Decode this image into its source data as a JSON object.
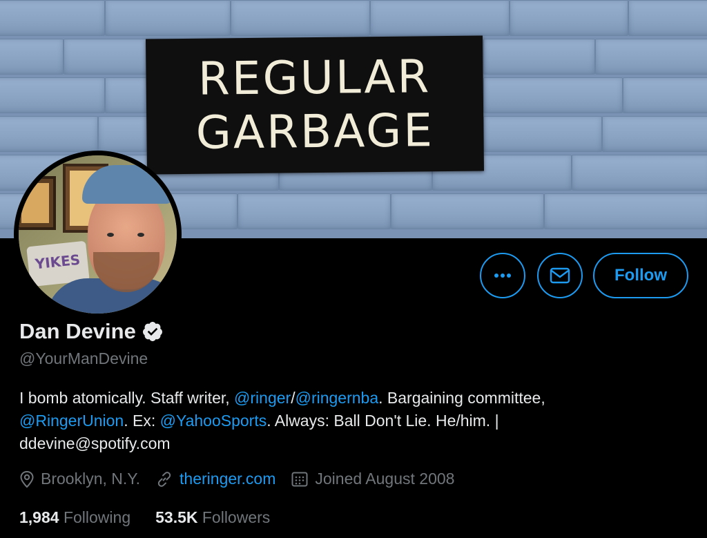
{
  "banner": {
    "sign_line1": "REGULAR",
    "sign_line2": "GARBAGE"
  },
  "avatar": {
    "pillow_text": "YIKES"
  },
  "actions": {
    "more_icon": "more-horizontal-icon",
    "message_icon": "mail-icon",
    "follow_label": "Follow"
  },
  "profile": {
    "name": "Dan Devine",
    "verified_icon": "verified-badge-icon",
    "handle": "@YourManDevine",
    "bio": {
      "t1": "I bomb atomically. Staff writer, ",
      "m1": "@ringer",
      "t2": "/",
      "m2": "@ringernba",
      "t3": ". Bargaining committee,",
      "m3": "@RingerUnion",
      "t4": ". Ex: ",
      "m4": "@YahooSports",
      "t5": ". Always: Ball Don't Lie. He/him. |",
      "t6": "ddevine@spotify.com"
    },
    "location": "Brooklyn, N.Y.",
    "website": "theringer.com",
    "joined": "Joined August 2008"
  },
  "stats": {
    "following_count": "1,984",
    "following_label": "Following",
    "followers_count": "53.5K",
    "followers_label": "Followers"
  },
  "colors": {
    "accent": "#1d9bf0",
    "secondary_text": "#71767b",
    "primary_text": "#e7e9ea",
    "background": "#000000"
  }
}
